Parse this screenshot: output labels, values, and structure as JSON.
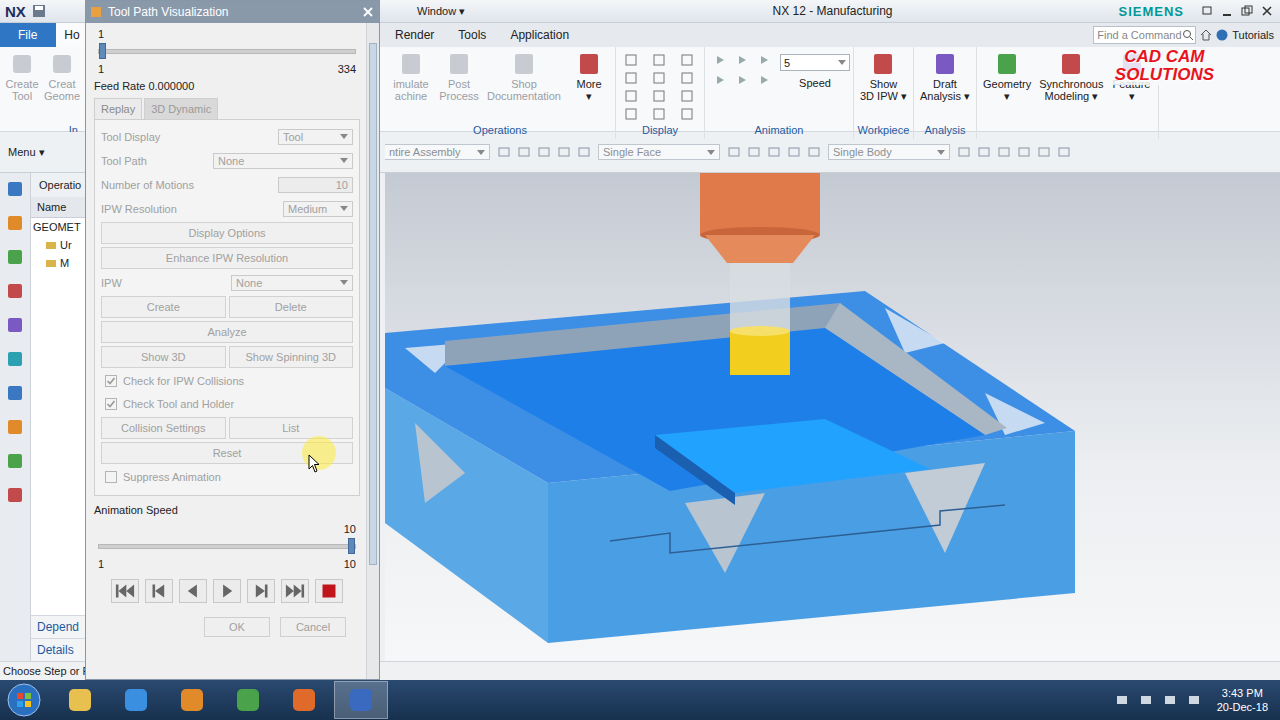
{
  "window": {
    "logo": "NX",
    "menu": "Window ▾",
    "title": "NX 12 - Manufacturing",
    "brand": "SIEMENS"
  },
  "ribbon_tabs": [
    {
      "label": "File",
      "selected": false,
      "kind": "file"
    },
    {
      "label": "Ho",
      "selected": true,
      "kind": "tab"
    },
    {
      "label": "Render",
      "selected": false,
      "kind": "tab"
    },
    {
      "label": "Tools",
      "selected": false,
      "kind": "tab"
    },
    {
      "label": "Application",
      "selected": false,
      "kind": "tab"
    }
  ],
  "search": {
    "placeholder": "Find a Command"
  },
  "help": {
    "label": "Tutorials"
  },
  "watermark": {
    "line1": "CAD CAM",
    "line2": "SOLUTIONS"
  },
  "ribbon_left": {
    "label": "In",
    "buttons": [
      {
        "lines": [
          "Create",
          "Tool"
        ],
        "disabled": true
      },
      {
        "lines": [
          "Creat",
          "Geome"
        ],
        "disabled": true
      }
    ]
  },
  "ribbon_groups": [
    {
      "label": "Operations",
      "kind": "buttons",
      "buttons": [
        {
          "lines": [
            "imulate",
            "achine"
          ],
          "disabled": true
        },
        {
          "lines": [
            "Post",
            "Process"
          ],
          "disabled": true
        },
        {
          "lines": [
            "Shop",
            "Documentation"
          ],
          "disabled": true
        },
        {
          "lines": [
            "More",
            "▾"
          ],
          "disabled": false
        }
      ]
    },
    {
      "label": "Display",
      "kind": "icons"
    },
    {
      "label": "Animation",
      "kind": "animation",
      "dropdown": "5",
      "caption": "Speed"
    },
    {
      "label": "Workpiece",
      "kind": "buttons",
      "buttons": [
        {
          "lines": [
            "Show",
            "3D IPW ▾"
          ],
          "disabled": false
        }
      ]
    },
    {
      "label": "Analysis",
      "kind": "buttons",
      "buttons": [
        {
          "lines": [
            "Draft",
            "Analysis ▾"
          ],
          "disabled": false
        }
      ]
    }
  ],
  "ribbon_extra": [
    {
      "lines": [
        "Geometry",
        "▾"
      ],
      "disabled": false
    },
    {
      "lines": [
        "Synchronous",
        "Modeling ▾"
      ],
      "disabled": false
    },
    {
      "lines": [
        "Feature",
        "▾"
      ],
      "disabled": false
    }
  ],
  "toolbar": {
    "menu": "Menu ▾",
    "filters": [
      {
        "label": "ntire Assembly"
      },
      {
        "label": "Single Face"
      },
      {
        "label": "Single Body"
      }
    ]
  },
  "navigator": {
    "header": "Operatio",
    "column": "Name",
    "rows": [
      {
        "label": "GEOMET",
        "kind": "root"
      },
      {
        "label": "Ur",
        "kind": "child"
      },
      {
        "label": "M",
        "kind": "child"
      }
    ],
    "panels": [
      "Depend",
      "Details"
    ]
  },
  "status_bar": {
    "text": "Choose Step or F"
  },
  "taskbar": {
    "time": "3:43 PM",
    "date": "20-Dec-18"
  },
  "dialog": {
    "title": "Tool Path Visualization",
    "motion_slider": {
      "value": "1",
      "min": "1",
      "max": "334",
      "level": 0
    },
    "feed_rate": "Feed Rate 0.000000",
    "tabs": [
      {
        "label": "Replay",
        "selected": false
      },
      {
        "label": "3D Dynamic",
        "selected": true
      }
    ],
    "rows": [
      {
        "kind": "dropdown",
        "label": "Tool Display",
        "value": "Tool",
        "disabled": true
      },
      {
        "kind": "dropdown",
        "label": "Tool Path",
        "value": "None",
        "disabled": true
      },
      {
        "kind": "input",
        "label": "Number of Motions",
        "value": "10",
        "disabled": true
      },
      {
        "kind": "dropdown",
        "label": "IPW Resolution",
        "value": "Medium",
        "disabled": true
      },
      {
        "kind": "buttons",
        "buttons": [
          "Display Options"
        ],
        "disabled": true
      },
      {
        "kind": "buttons",
        "buttons": [
          "Enhance IPW Resolution"
        ],
        "disabled": true
      },
      {
        "kind": "dropdown",
        "label": "IPW",
        "value": "None",
        "disabled": true
      },
      {
        "kind": "buttons",
        "buttons": [
          "Create",
          "Delete"
        ],
        "disabled": true
      },
      {
        "kind": "buttons",
        "buttons": [
          "Analyze"
        ],
        "disabled": true
      },
      {
        "kind": "buttons",
        "buttons": [
          "Show 3D",
          "Show Spinning 3D"
        ],
        "disabled": true
      },
      {
        "kind": "checkbox",
        "label": "Check for IPW Collisions",
        "checked": true,
        "disabled": true
      },
      {
        "kind": "checkbox",
        "label": "Check Tool and Holder",
        "checked": true,
        "disabled": true
      },
      {
        "kind": "buttons",
        "buttons": [
          "Collision Settings",
          "List"
        ],
        "disabled": true
      },
      {
        "kind": "buttons",
        "buttons": [
          "Reset"
        ],
        "disabled": true
      },
      {
        "kind": "checkbox",
        "label": "Suppress Animation",
        "checked": false,
        "disabled": true
      }
    ],
    "speed_label": "Animation Speed",
    "speed_slider": {
      "value": "10",
      "min": "1",
      "max": "10",
      "level": 1
    },
    "buttons": [
      {
        "label": "OK",
        "disabled": true
      },
      {
        "label": "Cancel",
        "disabled": true
      }
    ]
  }
}
